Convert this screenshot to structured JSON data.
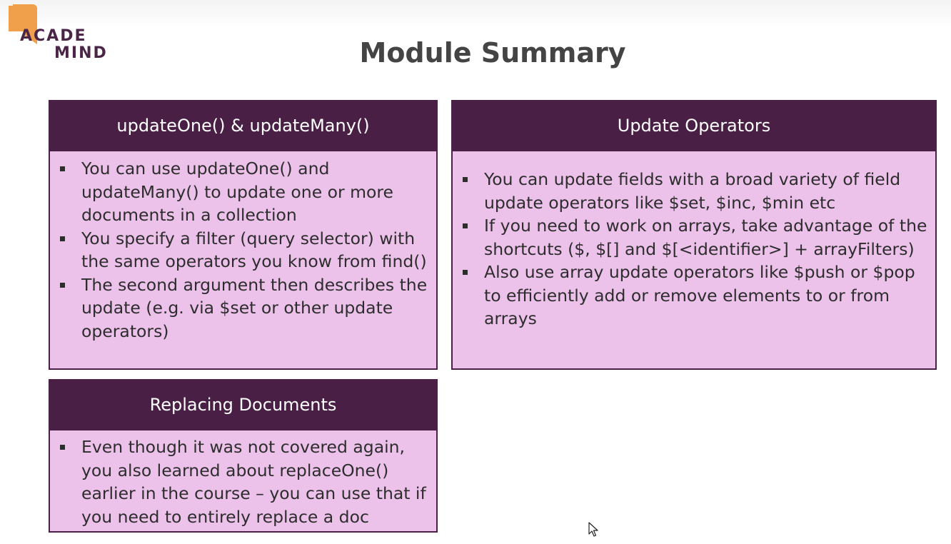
{
  "logo": {
    "line1": "ACADE",
    "line2": "MIND",
    "accent_color": "#f0a04b",
    "text_color": "#4a2548"
  },
  "title": "Module Summary",
  "colors": {
    "header_bg": "#4a1f46",
    "card_bg": "#ecc1ea",
    "text": "#2d2d2d"
  },
  "cards": [
    {
      "header": "updateOne() & updateMany()",
      "items": [
        "You can use updateOne() and updateMany() to update one or more documents in a collection",
        "You specify a filter (query selector) with the same operators you know from find()",
        "The second argument then describes the update (e.g. via $set or other update operators)"
      ]
    },
    {
      "header": "Update Operators",
      "items": [
        "You can update fields with a broad variety of field update operators like $set, $inc, $min etc",
        "If you need to work on arrays, take advantage of the shortcuts ($, $[] and $[<identifier>] + arrayFilters)",
        "Also use array update operators like $push or $pop to efficiently add or remove elements to or from arrays"
      ]
    },
    {
      "header": "Replacing Documents",
      "items": [
        "Even though it was not covered again, you also learned about replaceOne() earlier in the course – you can use that if you need to entirely replace a doc"
      ]
    }
  ]
}
